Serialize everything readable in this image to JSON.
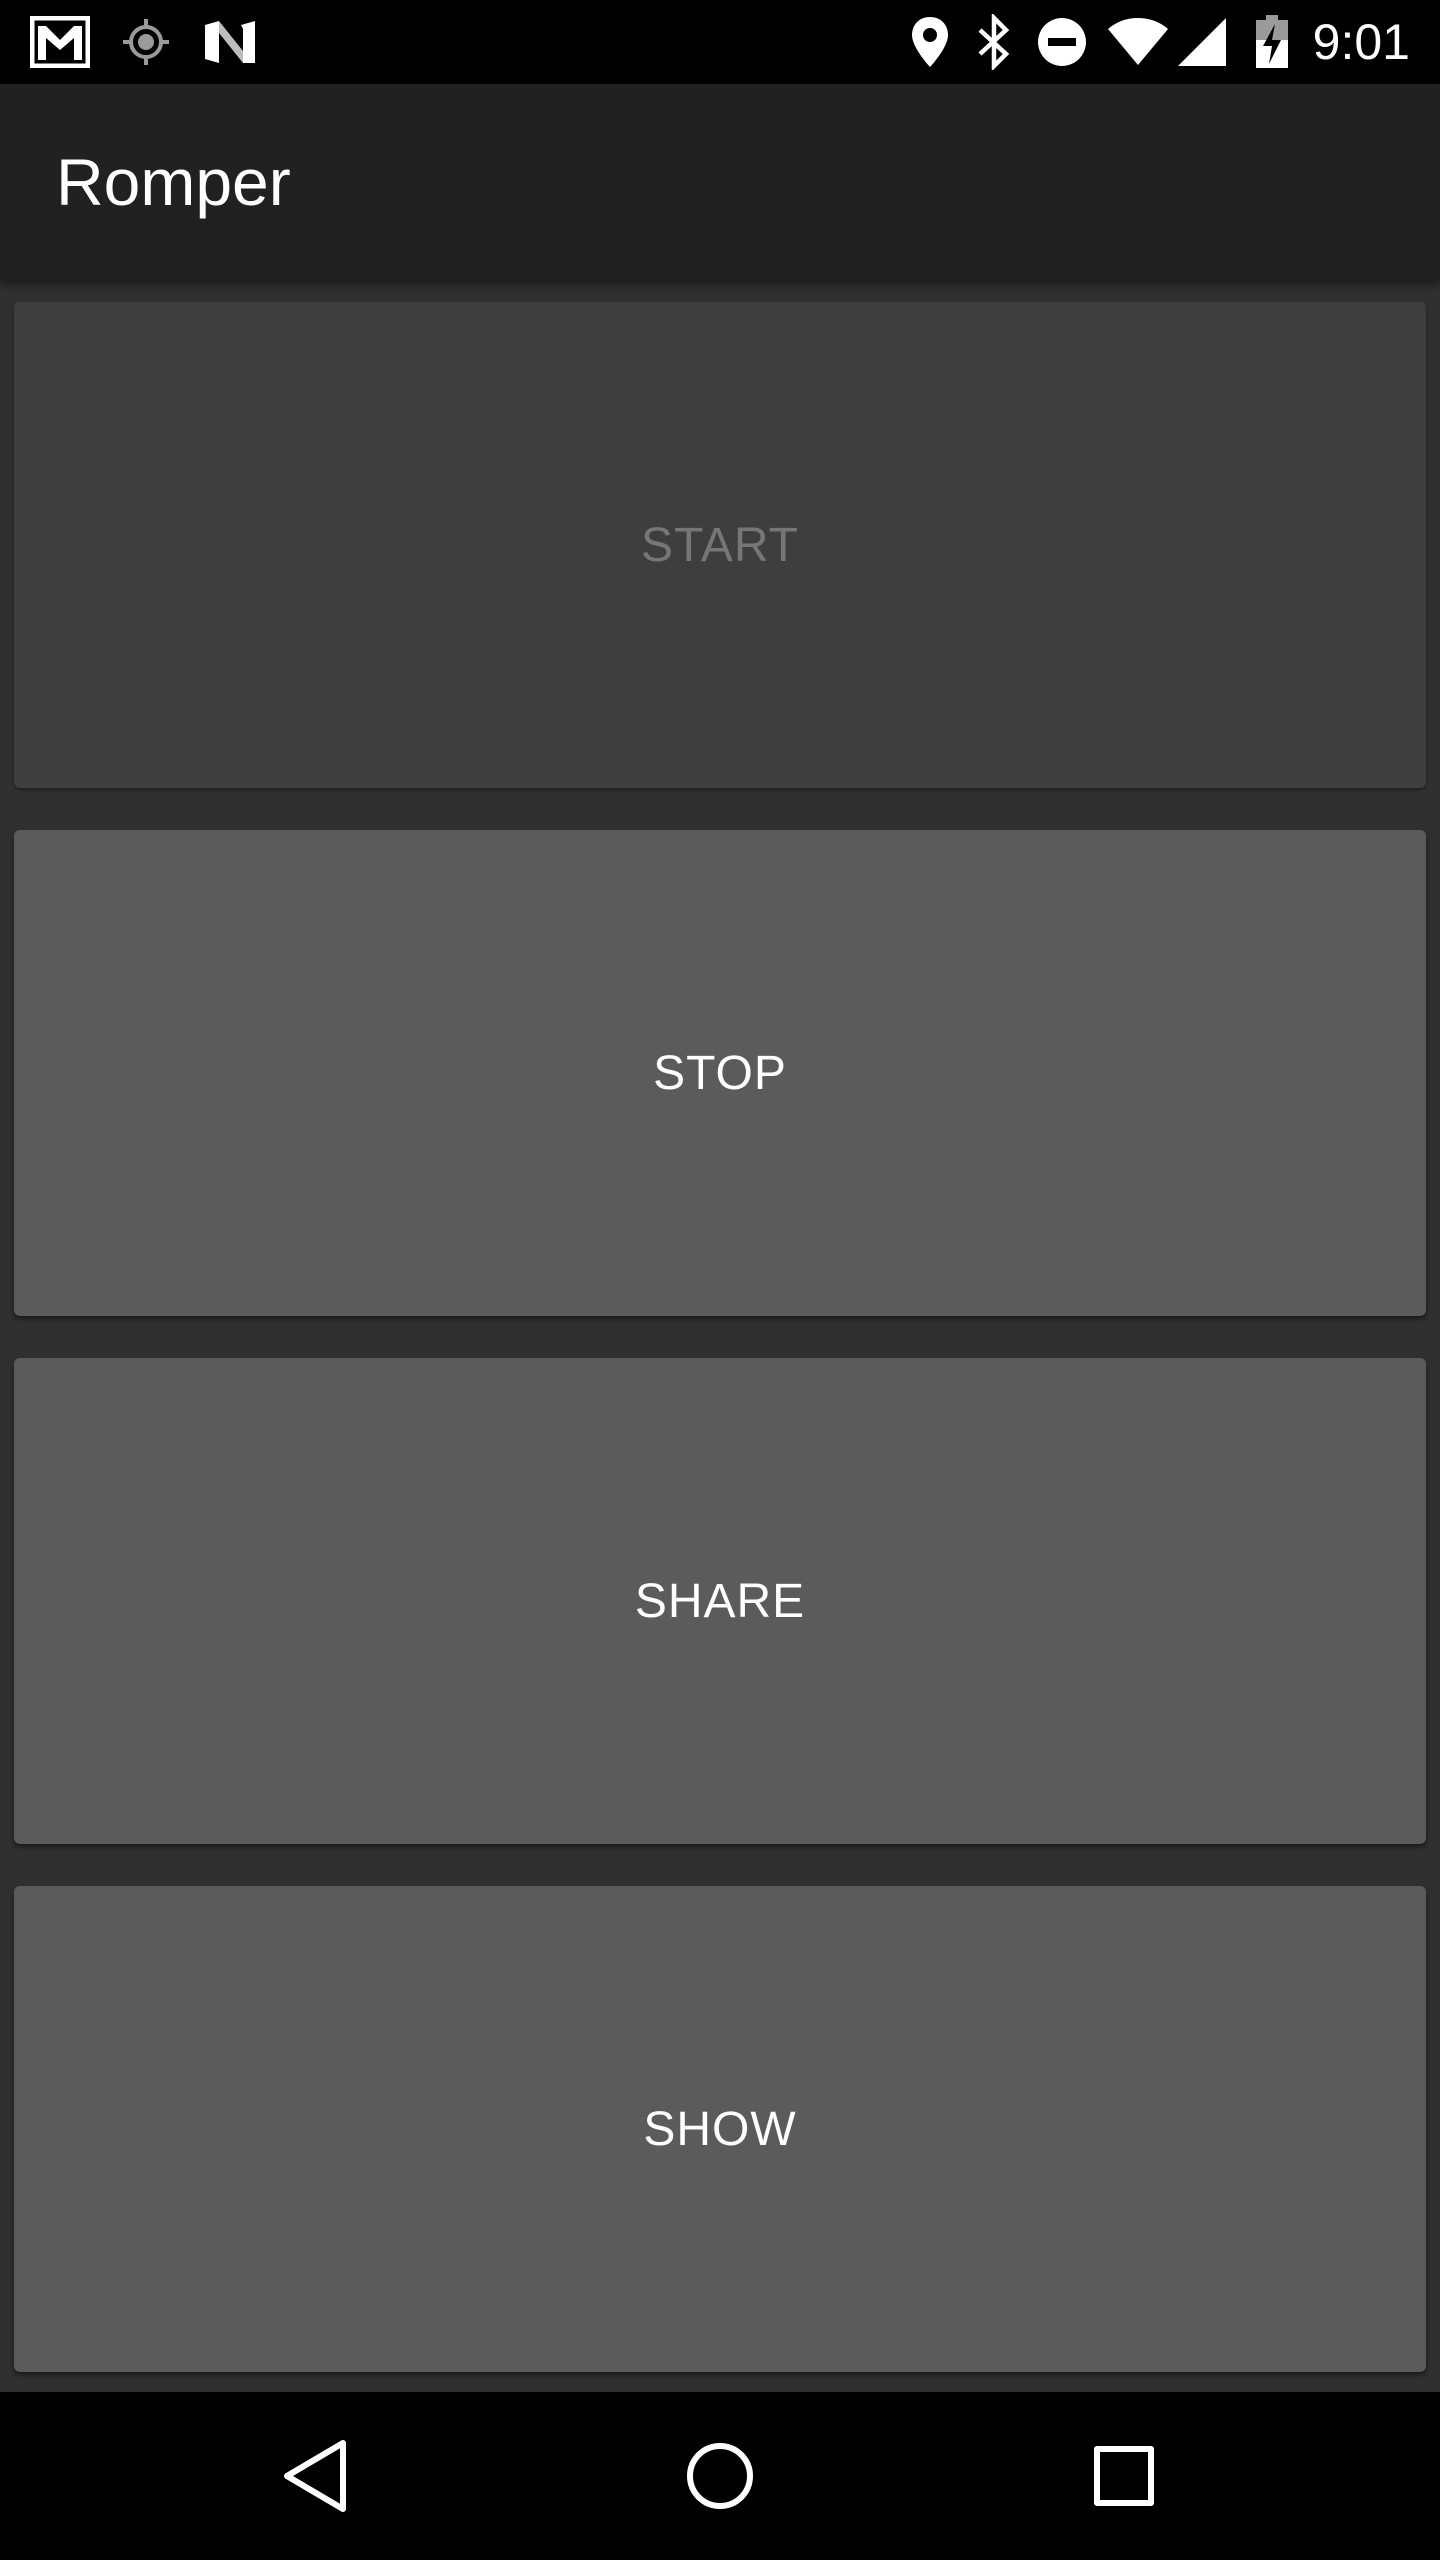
{
  "status_bar": {
    "time": "9:01",
    "left_icons": [
      "gmail-icon",
      "location-target-icon",
      "n-logo-icon"
    ],
    "right_icons": [
      "location-pin-icon",
      "bluetooth-icon",
      "do-not-disturb-icon",
      "wifi-icon",
      "cell-signal-icon",
      "battery-charging-icon"
    ]
  },
  "app_bar": {
    "title": "Romper"
  },
  "buttons": [
    {
      "label": "START",
      "enabled": false
    },
    {
      "label": "STOP",
      "enabled": true
    },
    {
      "label": "SHARE",
      "enabled": true
    },
    {
      "label": "SHOW",
      "enabled": true
    }
  ],
  "nav_bar": {
    "icons": [
      "back-icon",
      "home-icon",
      "recents-icon"
    ]
  },
  "colors": {
    "status_bar_bg": "#000000",
    "app_bar_bg": "#212121",
    "content_bg": "#303030",
    "button_bg": "#5b5b5c",
    "button_disabled_bg": "#3e3e3e",
    "button_text": "#ffffff",
    "button_disabled_text": "#767676"
  }
}
